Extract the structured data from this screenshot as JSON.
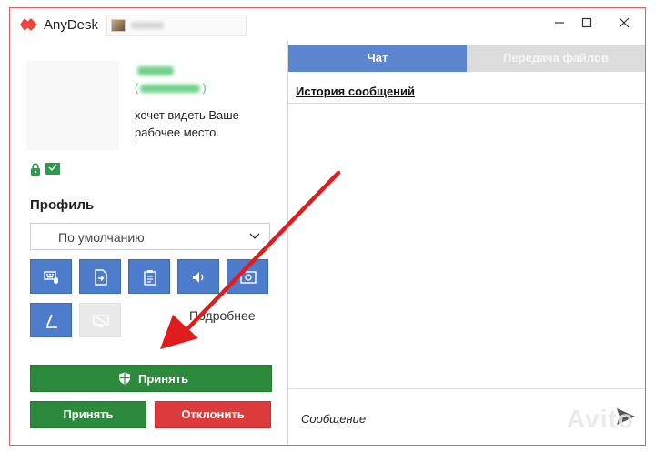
{
  "app": {
    "name": "AnyDesk"
  },
  "request": {
    "id_open": "(",
    "id_close": ")",
    "message": "хочет видеть Ваше рабочее место."
  },
  "profile": {
    "label": "Профиль",
    "selected": "По умолчанию"
  },
  "permissions": {
    "more_link": "Подробнее",
    "icons": [
      "keyboard-mouse-icon",
      "file-transfer-icon",
      "clipboard-icon",
      "sound-icon",
      "screenshot-icon",
      "draw-icon",
      "privacy-screen-icon"
    ]
  },
  "actions": {
    "accept_main": "Принять",
    "accept": "Принять",
    "decline": "Отклонить"
  },
  "tabs": {
    "chat": "Чат",
    "files": "Передача файлов"
  },
  "chat": {
    "history_title": "История сообщений",
    "message_placeholder": "Сообщение"
  },
  "watermark": "Avito",
  "colors": {
    "accept": "#2c8a3c",
    "decline": "#dd3b3b",
    "permission_blue": "#4e7ccc",
    "tab_active": "#5b86cf",
    "logo_red": "#ef443b",
    "annotation_arrow": "#e01d1d"
  }
}
